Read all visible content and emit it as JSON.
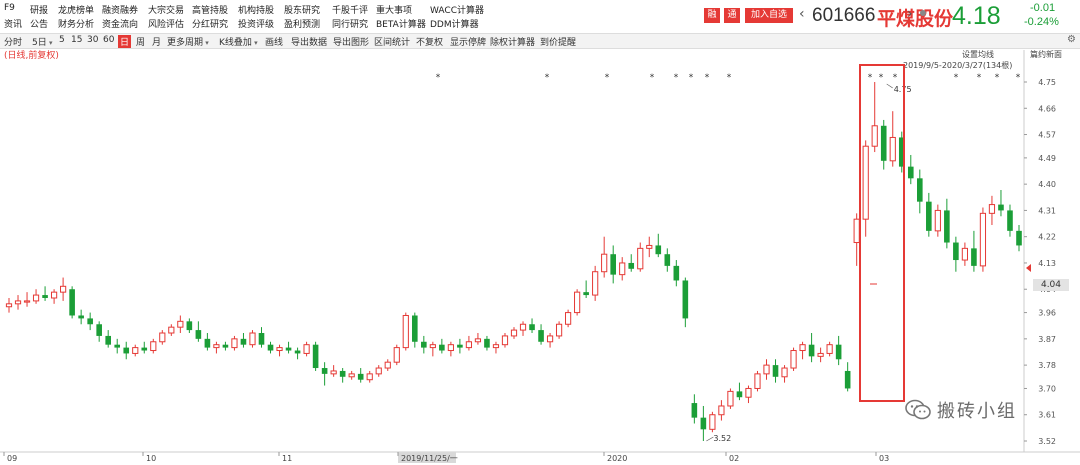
{
  "menu": {
    "row1": [
      "F9",
      "研报",
      "龙虎榜单",
      "融资融券",
      "大宗交易",
      "高管持股",
      "机构持股",
      "股东研究",
      "千股千评",
      "重大事项",
      "WACC计算器"
    ],
    "row2": [
      "资讯",
      "公告",
      "财务分析",
      "资金流向",
      "风险评估",
      "分红研究",
      "投资评级",
      "盈利预测",
      "同行研究",
      "BETA计算器",
      "DDM计算器"
    ]
  },
  "stock": {
    "tag_a": "融",
    "tag_b": "通",
    "add_label": "加入自选",
    "code": "601666",
    "name": "平煤股份",
    "price": "4.18",
    "change": "-0.01",
    "change_pct": "-0.24%",
    "up_color": "#e53935",
    "down_color": "#1b9e37"
  },
  "toolbar": {
    "items": [
      "分时",
      "5日",
      "5",
      "15",
      "30",
      "60",
      "日",
      "周",
      "月",
      "更多周期",
      "K线叠加",
      "画线",
      "导出数据",
      "导出图形",
      "区间统计",
      "不复权",
      "显示停牌",
      "除权计算器",
      "到价提醒"
    ],
    "active": "日"
  },
  "chart": {
    "sub_label": "(日线,前复权)",
    "ma_settings": "设置均线",
    "newest": "篇约新面",
    "range_text": "2019/9/5-2020/3/27(134根)",
    "watermark": "搬砖小组",
    "current_price_tag": "4.04",
    "highlight_color": "#e53935"
  },
  "chart_data": {
    "type": "candlestick",
    "y_ticks": [
      "4.75",
      "4.66",
      "4.57",
      "4.49",
      "4.40",
      "4.31",
      "4.22",
      "4.13",
      "4.04",
      "3.96",
      "3.87",
      "3.78",
      "3.70",
      "3.61",
      "3.52"
    ],
    "x_labels": [
      "09",
      "10",
      "11",
      "2019/11/25/一",
      "2020",
      "02",
      "03"
    ],
    "ylim": [
      3.5,
      4.78
    ],
    "annotations": [
      {
        "label": "4.75"
      },
      {
        "label": "3.52"
      }
    ],
    "ohlc": [
      [
        3.98,
        4.01,
        3.96,
        3.99
      ],
      [
        3.99,
        4.02,
        3.97,
        4.0
      ],
      [
        4.0,
        4.03,
        3.98,
        4.0
      ],
      [
        4.0,
        4.04,
        3.99,
        4.02
      ],
      [
        4.02,
        4.05,
        4.0,
        4.01
      ],
      [
        4.01,
        4.04,
        3.99,
        4.03
      ],
      [
        4.03,
        4.08,
        4.0,
        4.05
      ],
      [
        4.04,
        4.05,
        3.94,
        3.95
      ],
      [
        3.95,
        3.97,
        3.92,
        3.94
      ],
      [
        3.94,
        3.96,
        3.9,
        3.92
      ],
      [
        3.92,
        3.93,
        3.86,
        3.88
      ],
      [
        3.88,
        3.9,
        3.84,
        3.85
      ],
      [
        3.85,
        3.87,
        3.82,
        3.84
      ],
      [
        3.84,
        3.86,
        3.8,
        3.82
      ],
      [
        3.82,
        3.85,
        3.81,
        3.84
      ],
      [
        3.84,
        3.86,
        3.82,
        3.83
      ],
      [
        3.83,
        3.87,
        3.82,
        3.86
      ],
      [
        3.86,
        3.9,
        3.85,
        3.89
      ],
      [
        3.89,
        3.92,
        3.88,
        3.91
      ],
      [
        3.91,
        3.95,
        3.89,
        3.93
      ],
      [
        3.93,
        3.94,
        3.89,
        3.9
      ],
      [
        3.9,
        3.93,
        3.86,
        3.87
      ],
      [
        3.87,
        3.89,
        3.83,
        3.84
      ],
      [
        3.84,
        3.86,
        3.82,
        3.85
      ],
      [
        3.85,
        3.86,
        3.83,
        3.84
      ],
      [
        3.84,
        3.88,
        3.83,
        3.87
      ],
      [
        3.87,
        3.89,
        3.84,
        3.85
      ],
      [
        3.85,
        3.9,
        3.84,
        3.89
      ],
      [
        3.89,
        3.91,
        3.84,
        3.85
      ],
      [
        3.85,
        3.86,
        3.82,
        3.83
      ],
      [
        3.83,
        3.85,
        3.81,
        3.84
      ],
      [
        3.84,
        3.86,
        3.82,
        3.83
      ],
      [
        3.83,
        3.84,
        3.8,
        3.82
      ],
      [
        3.82,
        3.86,
        3.81,
        3.85
      ],
      [
        3.85,
        3.86,
        3.76,
        3.77
      ],
      [
        3.77,
        3.79,
        3.71,
        3.75
      ],
      [
        3.75,
        3.78,
        3.74,
        3.76
      ],
      [
        3.76,
        3.77,
        3.72,
        3.74
      ],
      [
        3.74,
        3.76,
        3.73,
        3.75
      ],
      [
        3.75,
        3.77,
        3.72,
        3.73
      ],
      [
        3.73,
        3.76,
        3.72,
        3.75
      ],
      [
        3.75,
        3.78,
        3.74,
        3.77
      ],
      [
        3.77,
        3.8,
        3.76,
        3.79
      ],
      [
        3.79,
        3.85,
        3.78,
        3.84
      ],
      [
        3.84,
        3.96,
        3.83,
        3.95
      ],
      [
        3.95,
        3.96,
        3.84,
        3.86
      ],
      [
        3.86,
        3.88,
        3.82,
        3.84
      ],
      [
        3.84,
        3.86,
        3.81,
        3.85
      ],
      [
        3.85,
        3.87,
        3.82,
        3.83
      ],
      [
        3.83,
        3.86,
        3.81,
        3.85
      ],
      [
        3.85,
        3.87,
        3.82,
        3.84
      ],
      [
        3.84,
        3.88,
        3.83,
        3.86
      ],
      [
        3.86,
        3.89,
        3.85,
        3.87
      ],
      [
        3.87,
        3.88,
        3.83,
        3.84
      ],
      [
        3.84,
        3.86,
        3.82,
        3.85
      ],
      [
        3.85,
        3.89,
        3.84,
        3.88
      ],
      [
        3.88,
        3.91,
        3.87,
        3.9
      ],
      [
        3.9,
        3.93,
        3.88,
        3.92
      ],
      [
        3.92,
        3.94,
        3.89,
        3.9
      ],
      [
        3.9,
        3.92,
        3.85,
        3.86
      ],
      [
        3.86,
        3.89,
        3.84,
        3.88
      ],
      [
        3.88,
        3.93,
        3.87,
        3.92
      ],
      [
        3.92,
        3.97,
        3.91,
        3.96
      ],
      [
        3.96,
        4.04,
        3.95,
        4.03
      ],
      [
        4.03,
        4.07,
        4.01,
        4.02
      ],
      [
        4.02,
        4.12,
        4.0,
        4.1
      ],
      [
        4.1,
        4.22,
        4.08,
        4.16
      ],
      [
        4.16,
        4.19,
        4.06,
        4.09
      ],
      [
        4.09,
        4.15,
        4.07,
        4.13
      ],
      [
        4.13,
        4.16,
        4.1,
        4.11
      ],
      [
        4.11,
        4.2,
        4.1,
        4.18
      ],
      [
        4.18,
        4.22,
        4.15,
        4.19
      ],
      [
        4.19,
        4.23,
        4.15,
        4.16
      ],
      [
        4.16,
        4.18,
        4.1,
        4.12
      ],
      [
        4.12,
        4.14,
        4.05,
        4.07
      ],
      [
        4.07,
        4.08,
        3.91,
        3.94
      ],
      [
        3.65,
        3.68,
        3.58,
        3.6
      ],
      [
        3.6,
        3.64,
        3.52,
        3.56
      ],
      [
        3.56,
        3.62,
        3.55,
        3.61
      ],
      [
        3.61,
        3.66,
        3.59,
        3.64
      ],
      [
        3.64,
        3.7,
        3.63,
        3.69
      ],
      [
        3.69,
        3.72,
        3.66,
        3.67
      ],
      [
        3.67,
        3.71,
        3.65,
        3.7
      ],
      [
        3.7,
        3.76,
        3.69,
        3.75
      ],
      [
        3.75,
        3.8,
        3.73,
        3.78
      ],
      [
        3.78,
        3.8,
        3.72,
        3.74
      ],
      [
        3.74,
        3.78,
        3.72,
        3.77
      ],
      [
        3.77,
        3.84,
        3.76,
        3.83
      ],
      [
        3.83,
        3.86,
        3.8,
        3.85
      ],
      [
        3.85,
        3.89,
        3.79,
        3.81
      ],
      [
        3.81,
        3.84,
        3.79,
        3.82
      ],
      [
        3.82,
        3.86,
        3.81,
        3.85
      ],
      [
        3.85,
        3.88,
        3.78,
        3.8
      ],
      [
        3.76,
        3.79,
        3.69,
        3.7
      ],
      [
        4.2,
        4.3,
        4.12,
        4.28
      ],
      [
        4.28,
        4.55,
        4.22,
        4.53
      ],
      [
        4.53,
        4.75,
        4.51,
        4.6
      ],
      [
        4.6,
        4.62,
        4.45,
        4.48
      ],
      [
        4.48,
        4.65,
        4.46,
        4.56
      ],
      [
        4.56,
        4.58,
        4.44,
        4.46
      ],
      [
        4.46,
        4.5,
        4.4,
        4.42
      ],
      [
        4.42,
        4.45,
        4.3,
        4.34
      ],
      [
        4.34,
        4.37,
        4.22,
        4.24
      ],
      [
        4.24,
        4.33,
        4.22,
        4.31
      ],
      [
        4.31,
        4.35,
        4.18,
        4.2
      ],
      [
        4.2,
        4.22,
        4.1,
        4.14
      ],
      [
        4.14,
        4.2,
        4.12,
        4.18
      ],
      [
        4.18,
        4.24,
        4.1,
        4.12
      ],
      [
        4.12,
        4.32,
        4.1,
        4.3
      ],
      [
        4.3,
        4.36,
        4.26,
        4.33
      ],
      [
        4.33,
        4.38,
        4.29,
        4.31
      ],
      [
        4.31,
        4.33,
        4.22,
        4.24
      ],
      [
        4.24,
        4.26,
        4.17,
        4.19
      ]
    ]
  }
}
